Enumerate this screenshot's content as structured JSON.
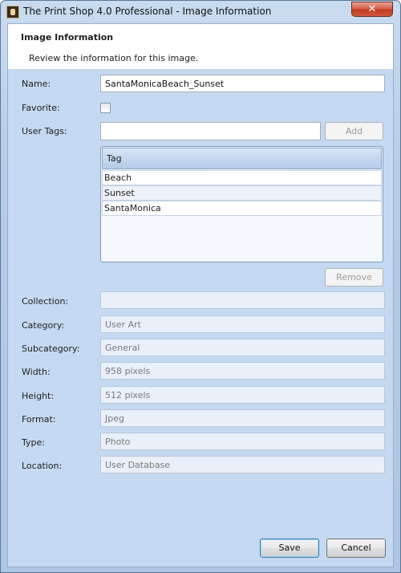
{
  "window": {
    "title": "The Print Shop 4.0 Professional - Image Information",
    "close_glyph": "✕"
  },
  "header": {
    "title": "Image Information",
    "description": "Review the information for this image."
  },
  "fields": {
    "name": {
      "label": "Name:",
      "value": "SantaMonicaBeach_Sunset"
    },
    "favorite": {
      "label": "Favorite:",
      "checked": false
    },
    "user_tags": {
      "label": "User Tags:",
      "value": ""
    },
    "collection": {
      "label": "Collection:",
      "value": ""
    },
    "category": {
      "label": "Category:",
      "value": "User Art"
    },
    "subcategory": {
      "label": "Subcategory:",
      "value": "General"
    },
    "width": {
      "label": "Width:",
      "value": "958 pixels"
    },
    "height": {
      "label": "Height:",
      "value": "512 pixels"
    },
    "format": {
      "label": "Format:",
      "value": "Jpeg"
    },
    "type": {
      "label": "Type:",
      "value": "Photo"
    },
    "location": {
      "label": "Location:",
      "value": "User Database"
    }
  },
  "tags": {
    "header": "Tag",
    "items": [
      "Beach",
      "Sunset",
      "SantaMonica"
    ]
  },
  "buttons": {
    "add": "Add",
    "remove": "Remove",
    "save": "Save",
    "cancel": "Cancel"
  }
}
